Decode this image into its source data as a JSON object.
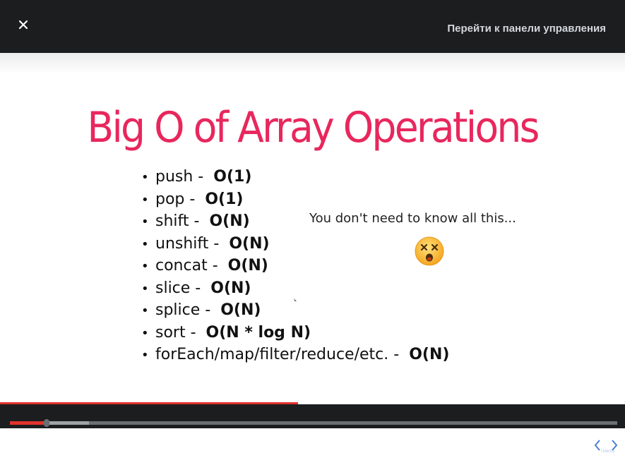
{
  "header": {
    "close_icon": "close-icon",
    "dashboard_link": "Перейти к панели управления"
  },
  "slide": {
    "title": "Big O of Array Operations",
    "operations": [
      {
        "name": "push -",
        "complexity": "O(1)"
      },
      {
        "name": "pop -",
        "complexity": "O(1)"
      },
      {
        "name": "shift -",
        "complexity": "O(N)"
      },
      {
        "name": "unshift -",
        "complexity": "O(N)"
      },
      {
        "name": "concat -",
        "complexity": "O(N)"
      },
      {
        "name": "slice -",
        "complexity": "O(N)"
      },
      {
        "name": "splice -",
        "complexity": "O(N)"
      },
      {
        "name": "sort -",
        "complexity": "O(N * log N)"
      },
      {
        "name": "forEach/map/filter/reduce/etc. -",
        "complexity": "O(N)"
      }
    ],
    "note": "You don't need to know all this...",
    "emoji": "dizzy-face-emoji"
  },
  "player": {
    "accent_color": "#e0332f",
    "progress_fraction": 0.06,
    "buffered_fraction": 0.13
  }
}
